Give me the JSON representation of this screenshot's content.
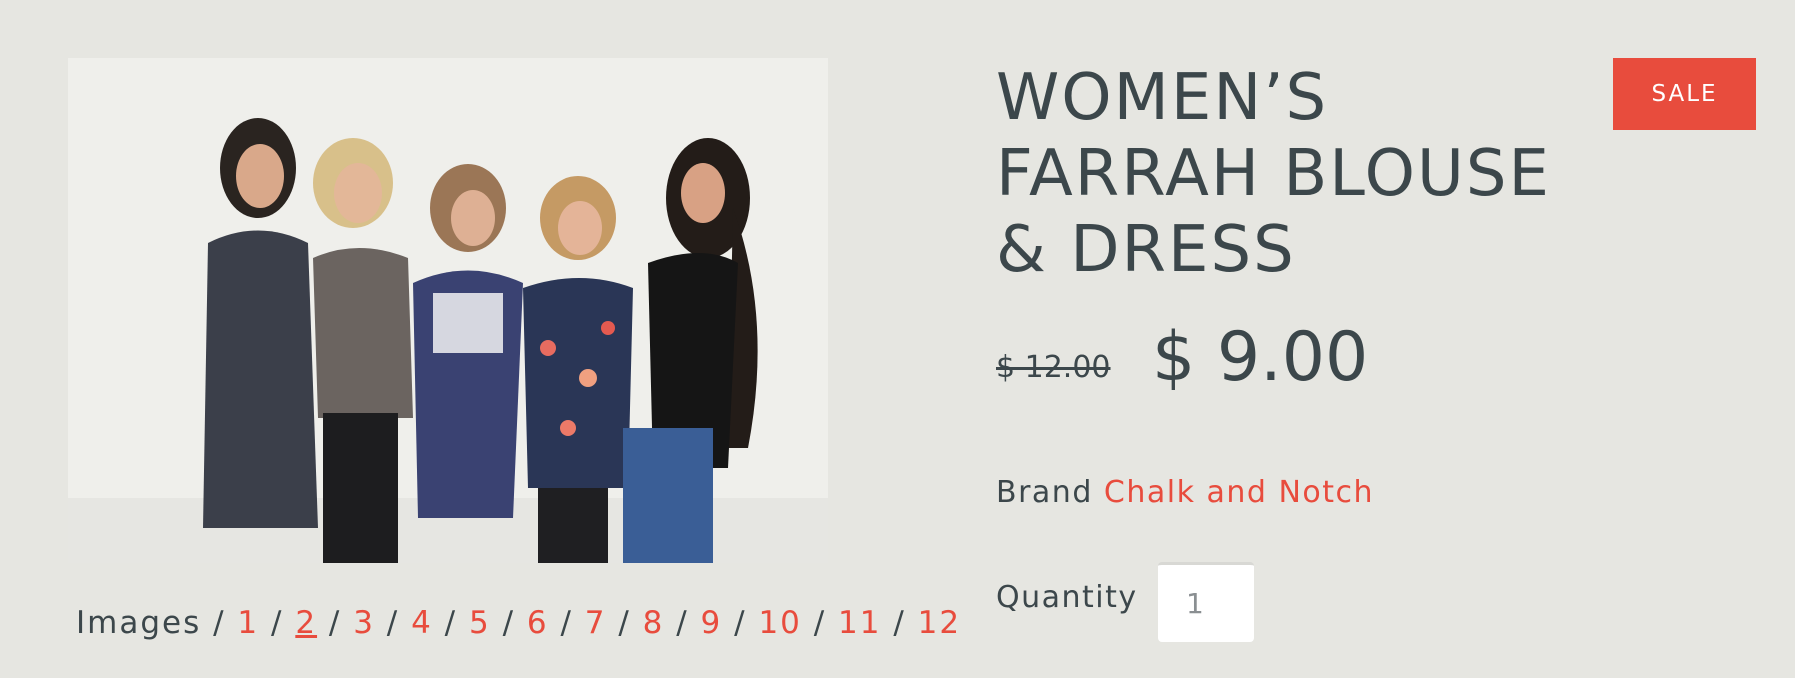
{
  "product": {
    "title": "WOMEN’S FARRAH BLOUSE & DRESS",
    "badge": "SALE",
    "compare_price": "$ 12.00",
    "price": "$ 9.00",
    "brand_label": "Brand",
    "brand_name": "Chalk and Notch",
    "quantity_label": "Quantity",
    "quantity_value": "1"
  },
  "gallery": {
    "label": "Images",
    "separator": "/",
    "pages": [
      "1",
      "2",
      "3",
      "4",
      "5",
      "6",
      "7",
      "8",
      "9",
      "10",
      "11",
      "12"
    ],
    "current": "2",
    "image_icon": "photo-of-five-women"
  },
  "colors": {
    "accent": "#e84c3d",
    "text": "#3c474b",
    "background": "#e6e6e1"
  }
}
